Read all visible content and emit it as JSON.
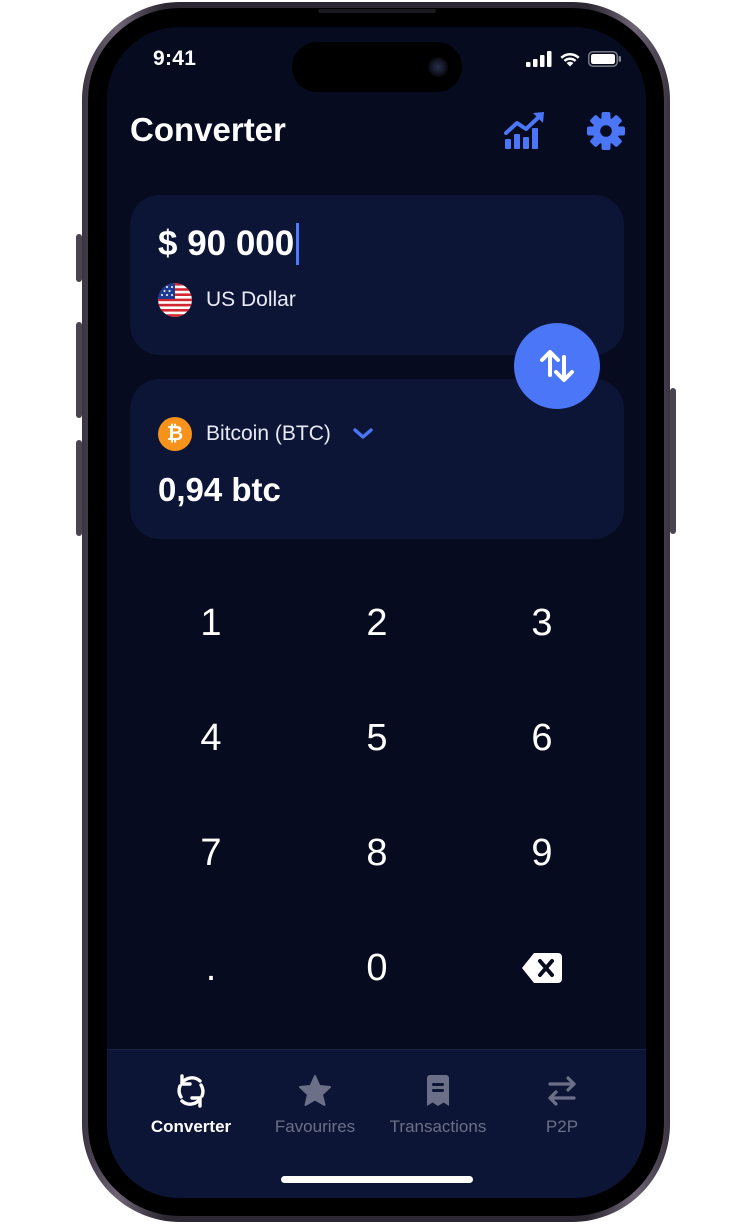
{
  "status_bar": {
    "time": "9:41"
  },
  "header": {
    "title": "Converter",
    "chart_icon": "chart-growth-icon",
    "settings_icon": "gear-icon"
  },
  "from_card": {
    "amount": "$ 90 000",
    "currency_name": "US Dollar",
    "flag_icon": "us-flag-icon"
  },
  "to_card": {
    "currency_name": "Bitcoin (BTC)",
    "coin_symbol": "₿",
    "amount": "0,94 btc"
  },
  "swap_icon": "swap-arrows-icon",
  "keypad": {
    "keys": [
      "1",
      "2",
      "3",
      "4",
      "5",
      "6",
      "7",
      "8",
      "9",
      ".",
      "0"
    ],
    "backspace_icon": "backspace-icon"
  },
  "tabbar": {
    "tabs": [
      {
        "label": "Converter",
        "icon": "refresh-icon",
        "active": true
      },
      {
        "label": "Favourires",
        "icon": "star-icon",
        "active": false
      },
      {
        "label": "Transactions",
        "icon": "receipt-icon",
        "active": false
      },
      {
        "label": "P2P",
        "icon": "transfer-icon",
        "active": false
      }
    ]
  },
  "colors": {
    "background": "#070b1f",
    "card": "#0d1537",
    "accent": "#4a76f7",
    "bitcoin": "#f7931a",
    "inactive_tab": "#6b7088"
  }
}
